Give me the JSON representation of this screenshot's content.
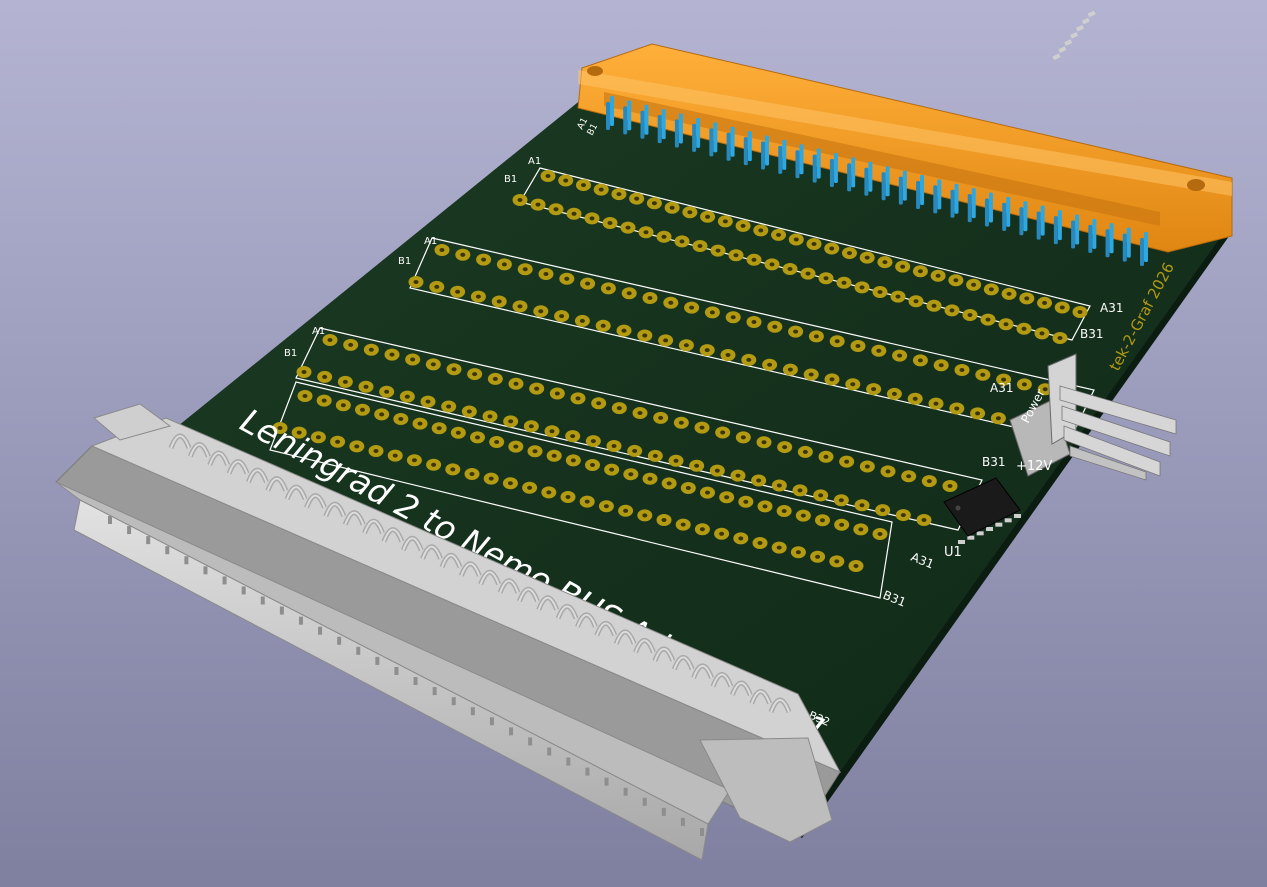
{
  "board": {
    "title": "Leningrad 2 to Nemo BUS Adapter v 3.1",
    "credit": "tek-2-Graf 2026",
    "power_label": "Power",
    "v12_label": "+12V",
    "u1_label": "U1"
  },
  "connector_labels": {
    "a1": "A1",
    "b1": "B1",
    "a31": "A31",
    "b31": "B31",
    "b32": "B32"
  },
  "colors": {
    "pcb": "#14301c",
    "pad": "#b29a12",
    "orange_connector": "#f59a1c",
    "pins": "#2fa8e0",
    "gray_connector": "#c8c8c8",
    "silkscreen": "#ffffff"
  },
  "pad_rows": {
    "rows": 3,
    "pins_per_row": 31
  }
}
